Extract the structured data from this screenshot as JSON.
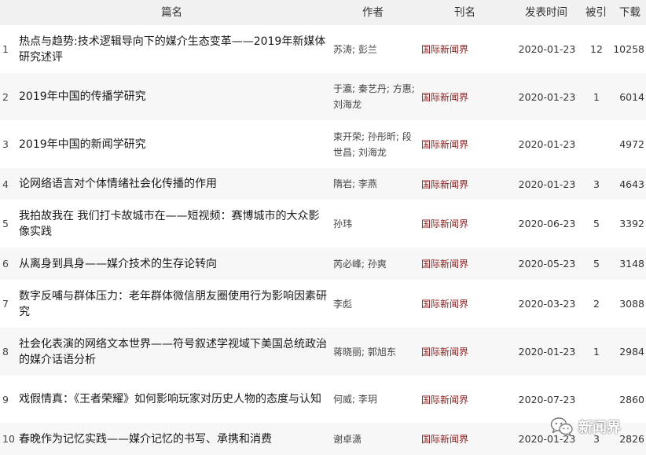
{
  "table": {
    "headers": {
      "title": "篇名",
      "author": "作者",
      "journal": "刊名",
      "date": "发表时间",
      "cited": "被引",
      "download": "下载"
    },
    "rows": [
      {
        "index": "1",
        "title": "热点与趋势:技术逻辑导向下的媒介生态变革——2019年新媒体研究述评",
        "authors": "苏涛; 彭兰",
        "journal": "国际新闻界",
        "date": "2020-01-23",
        "cited": "12",
        "downloads": "10258"
      },
      {
        "index": "2",
        "title": "2019年中国的传播学研究",
        "authors": "于瀛; 秦艺丹; 方惠; 刘海龙",
        "journal": "国际新闻界",
        "date": "2020-01-23",
        "cited": "1",
        "downloads": "6014"
      },
      {
        "index": "3",
        "title": "2019年中国的新闻学研究",
        "authors": "束开荣; 孙彤昕; 段世昌; 刘海龙",
        "journal": "国际新闻界",
        "date": "2020-01-23",
        "cited": "",
        "downloads": "4972"
      },
      {
        "index": "4",
        "title": "论网络语言对个体情绪社会化传播的作用",
        "authors": "隋岩; 李燕",
        "journal": "国际新闻界",
        "date": "2020-01-23",
        "cited": "3",
        "downloads": "4643"
      },
      {
        "index": "5",
        "title": "我拍故我在 我们打卡故城市在——短视频：赛博城市的大众影像实践",
        "authors": "孙玮",
        "journal": "国际新闻界",
        "date": "2020-06-23",
        "cited": "5",
        "downloads": "3392"
      },
      {
        "index": "6",
        "title": "从离身到具身——媒介技术的生存论转向",
        "authors": "芮必峰; 孙爽",
        "journal": "国际新闻界",
        "date": "2020-05-23",
        "cited": "5",
        "downloads": "3148"
      },
      {
        "index": "7",
        "title": "数字反哺与群体压力：老年群体微信朋友圈使用行为影响因素研究",
        "authors": "李彪",
        "journal": "国际新闻界",
        "date": "2020-03-23",
        "cited": "2",
        "downloads": "3088"
      },
      {
        "index": "8",
        "title": "社会化表演的网络文本世界——符号叙述学视域下美国总统政治的媒介话语分析",
        "authors": "蒋晓丽; 郭旭东",
        "journal": "国际新闻界",
        "date": "2020-01-23",
        "cited": "1",
        "downloads": "2984"
      },
      {
        "index": "9",
        "title": "戏假情真：《王者荣耀》如何影响玩家对历史人物的态度与认知",
        "authors": "何威; 李玥",
        "journal": "国际新闻界",
        "date": "2020-07-23",
        "cited": "",
        "downloads": "2860"
      },
      {
        "index": "10",
        "title": "春晚作为记忆实践——媒介记忆的书写、承携和消费",
        "authors": "谢卓潇",
        "journal": "国际新闻界",
        "date": "2020-01-23",
        "cited": "3",
        "downloads": "2826"
      }
    ]
  },
  "watermark": {
    "text": "新闻界",
    "icon": "wechat-icon"
  }
}
